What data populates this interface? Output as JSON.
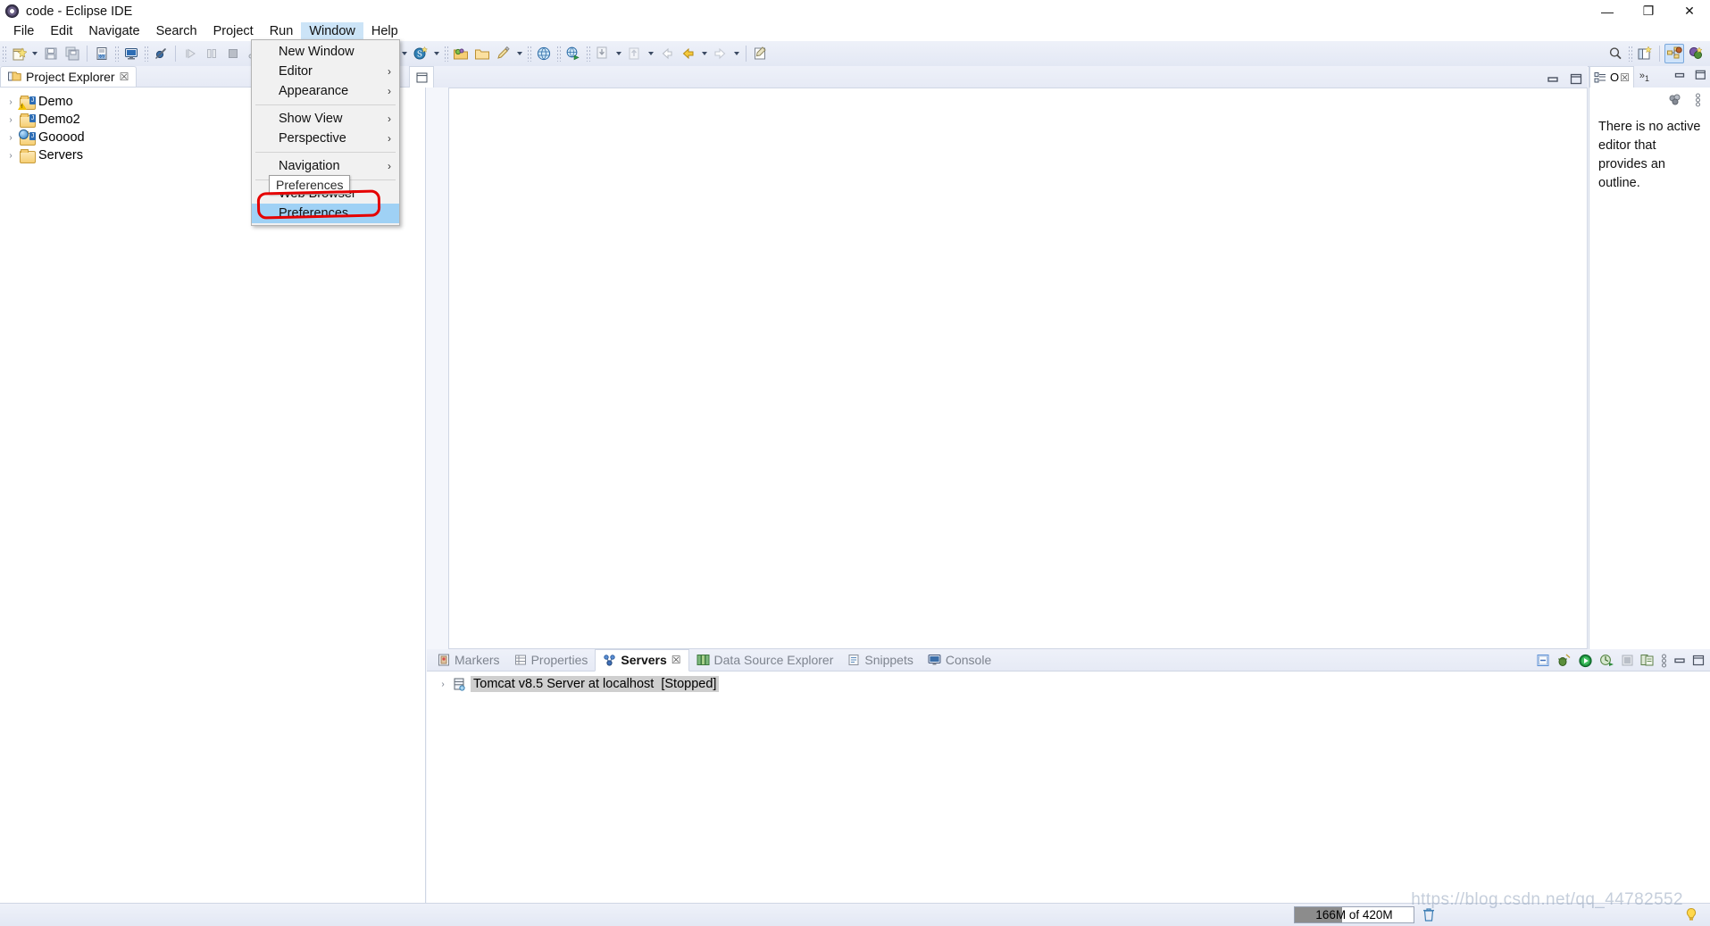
{
  "window": {
    "title": "code - Eclipse IDE",
    "icon": "eclipse-icon",
    "minimize": "—",
    "restore": "❐",
    "close": "✕"
  },
  "menubar": {
    "items": [
      {
        "label": "File",
        "active": false
      },
      {
        "label": "Edit",
        "active": false
      },
      {
        "label": "Navigate",
        "active": false
      },
      {
        "label": "Search",
        "active": false
      },
      {
        "label": "Project",
        "active": false
      },
      {
        "label": "Run",
        "active": false
      },
      {
        "label": "Window",
        "active": true
      },
      {
        "label": "Help",
        "active": false
      }
    ]
  },
  "window_menu": {
    "items": [
      {
        "label": "New Window",
        "submenu": false,
        "selected": false
      },
      {
        "label": "Editor",
        "submenu": true,
        "selected": false
      },
      {
        "label": "Appearance",
        "submenu": true,
        "selected": false
      },
      {
        "separator_after": true
      },
      {
        "label": "Show View",
        "submenu": true,
        "selected": false
      },
      {
        "label": "Perspective",
        "submenu": true,
        "selected": false
      },
      {
        "label": "Navigation",
        "submenu": true,
        "selected": false
      },
      {
        "label": "Web Browser",
        "submenu": true,
        "selected": false
      },
      {
        "label": "Preferences",
        "submenu": false,
        "selected": true
      }
    ],
    "submenu_arrow": "›",
    "tooltip": "Preferences"
  },
  "project_explorer": {
    "tab_label": "Project Explorer",
    "close_glyph": "☒",
    "expand_arrow": "›",
    "items": [
      {
        "label": "Demo",
        "badge": "warning"
      },
      {
        "label": "Demo2",
        "badge": "none"
      },
      {
        "label": "Gooood",
        "badge": "web"
      },
      {
        "label": "Servers",
        "badge": "plain"
      }
    ]
  },
  "editor": {
    "minimize_glyph": "▬",
    "maximize_glyph": "☐"
  },
  "outline": {
    "tab_label": "O",
    "close_glyph": "☒",
    "overflow_glyph": "»",
    "overflow_count": "1",
    "minimize_glyph": "▬",
    "maximize_glyph": "☐",
    "message": "There is no active editor that provides an outline.",
    "tool_icons": [
      "link-with-editor-icon",
      "view-menu-icon"
    ]
  },
  "bottom_panel": {
    "tabs": [
      {
        "label": "Markers",
        "icon": "markers-icon",
        "active": false
      },
      {
        "label": "Properties",
        "icon": "properties-icon",
        "active": false
      },
      {
        "label": "Servers",
        "icon": "servers-icon",
        "active": true
      },
      {
        "label": "Data Source Explorer",
        "icon": "datasource-icon",
        "active": false
      },
      {
        "label": "Snippets",
        "icon": "snippets-icon",
        "active": false
      },
      {
        "label": "Console",
        "icon": "console-icon",
        "active": false
      }
    ],
    "active_tab_close": "☒",
    "rows": [
      {
        "expand": "›",
        "icon": "server-icon",
        "name": "Tomcat v8.5 Server at localhost",
        "state": "[Stopped]"
      }
    ],
    "controls": [
      "new-server-icon",
      "debug-icon",
      "start-icon",
      "profile-icon",
      "stop-icon",
      "publish-icon",
      "view-menu-icon",
      "minimize-icon",
      "maximize-icon"
    ]
  },
  "toolbar": {
    "left_icons": [
      "new-wizard-icon",
      "new-dropdown-caret",
      "save-icon",
      "save-all-icon",
      "toggle-breadcrumb-icon",
      "open-console-icon",
      "skip-breakpoints-icon",
      "resume-icon",
      "suspend-icon",
      "terminate-icon",
      "disconnect-icon"
    ],
    "mid_icons": [
      "run-icon",
      "run-caret",
      "debug-icon",
      "debug-caret",
      "coverage-icon",
      "coverage-caret",
      "new-java-project-icon",
      "new-java-caret",
      "new-spring-icon",
      "new-spring-caret",
      "open-type-icon",
      "open-task-icon",
      "annotation-icon",
      "annotation-caret",
      "search-web-icon",
      "external-tools-icon",
      "import-icon",
      "import-caret",
      "export-icon",
      "export-caret",
      "back-icon",
      "forward-yellow-icon",
      "forward-caret",
      "next-icon",
      "next-caret",
      "edit-icon"
    ],
    "right_icons": [
      "search-icon",
      "new-perspective-icon",
      "java-ee-perspective-icon",
      "java-perspective-icon"
    ]
  },
  "statusbar": {
    "heap_text": "166M of 420M",
    "heap_percent": 40,
    "trash_icon": "trash-icon",
    "tip_icon": "lightbulb-icon"
  },
  "watermark": "https://blog.csdn.net/qq_44782552",
  "colors": {
    "menu_highlight": "#cce4f7",
    "dropdown_selected": "#9fd1f5",
    "annotation_red": "#e50000",
    "toolbar_bg": "#e3e8f4"
  }
}
